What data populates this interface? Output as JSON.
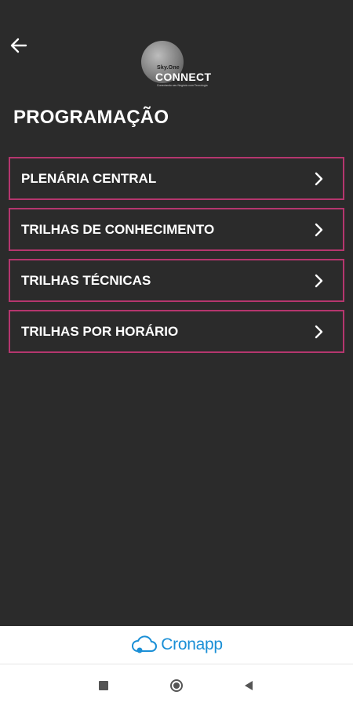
{
  "header": {
    "back_icon": "arrow-left-icon",
    "logo": {
      "small_text": "Sky.One",
      "big_text": "CONNECT",
      "tagline": "Conectando seu Negócio com Tecnologia"
    }
  },
  "page_title": "PROGRAMAÇÃO",
  "menu": {
    "items": [
      {
        "label": "PLENÁRIA CENTRAL",
        "icon": "chevron-right-icon"
      },
      {
        "label": "TRILHAS DE CONHECIMENTO",
        "icon": "chevron-right-icon"
      },
      {
        "label": "TRILHAS TÉCNICAS",
        "icon": "chevron-right-icon"
      },
      {
        "label": "TRILHAS POR HORÁRIO",
        "icon": "chevron-right-icon"
      }
    ]
  },
  "footer": {
    "brand": "Cronapp",
    "brand_icon": "cloud-icon"
  },
  "navbar": {
    "icons": [
      "recents-square-icon",
      "home-circle-icon",
      "back-triangle-icon"
    ]
  },
  "colors": {
    "background": "#2b2b2b",
    "accent_border": "#b5366e",
    "brand_blue": "#1a8fd6"
  }
}
